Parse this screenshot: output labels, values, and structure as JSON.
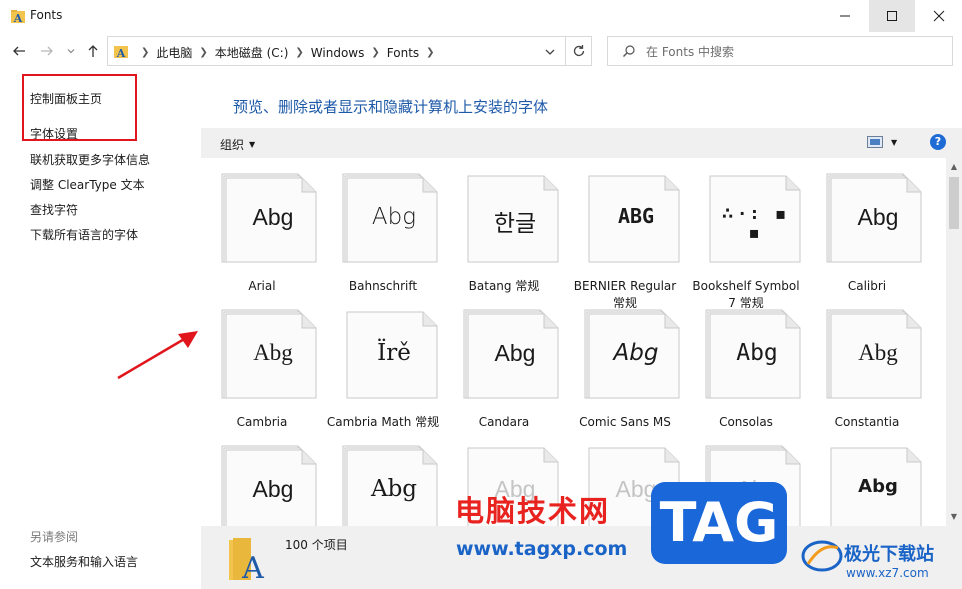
{
  "window": {
    "title": "Fonts"
  },
  "address": {
    "crumbs": [
      "此电脑",
      "本地磁盘 (C:)",
      "Windows",
      "Fonts"
    ]
  },
  "search": {
    "placeholder": "在 Fonts 中搜索"
  },
  "sidebar": {
    "links": [
      "控制面板主页",
      "字体设置",
      "联机获取更多字体信息",
      "调整 ClearType 文本",
      "查找字符",
      "下载所有语言的字体"
    ],
    "see_also_title": "另请参阅",
    "see_also_links": [
      "文本服务和输入语言"
    ]
  },
  "main": {
    "header": "预览、删除或者显示和隐藏计算机上安装的字体",
    "organize_label": "组织",
    "help_label": "?"
  },
  "fonts": [
    {
      "name": "Arial",
      "sample": "Abg"
    },
    {
      "name": "Bahnschrift",
      "sample": "Abg"
    },
    {
      "name": "Batang 常规",
      "sample": "한글"
    },
    {
      "name": "BERNIER Regular 常规",
      "sample": "ABG"
    },
    {
      "name": "Bookshelf Symbol 7 常规",
      "sample": "∴·: ▪ ▪"
    },
    {
      "name": "Calibri",
      "sample": "Abg"
    },
    {
      "name": "Cambria",
      "sample": "Abg"
    },
    {
      "name": "Cambria Math 常规",
      "sample": "Ïrě"
    },
    {
      "name": "Candara",
      "sample": "Abg"
    },
    {
      "name": "Comic Sans MS",
      "sample": "Abg"
    },
    {
      "name": "Consolas",
      "sample": "Abg"
    },
    {
      "name": "Constantia",
      "sample": "Abg"
    },
    {
      "name": "",
      "sample": "Abg"
    },
    {
      "name": "",
      "sample": "Abg"
    },
    {
      "name": "",
      "sample": "Abg"
    },
    {
      "name": "",
      "sample": "Abg"
    },
    {
      "name": "",
      "sample": "Abg"
    },
    {
      "name": "",
      "sample": "Abg"
    }
  ],
  "status": {
    "item_count": "100 个项目"
  },
  "watermarks": {
    "site1_name": "电脑技术网",
    "site1_url": "www.tagxp.com",
    "tag": "TAG",
    "site2_name": "极光下载站",
    "site2_url": "www.xz7.com"
  },
  "colors": {
    "accent_blue": "#1e5aa8",
    "highlight_red": "#e0161c",
    "toolbar_gray": "#f0f0f0"
  }
}
